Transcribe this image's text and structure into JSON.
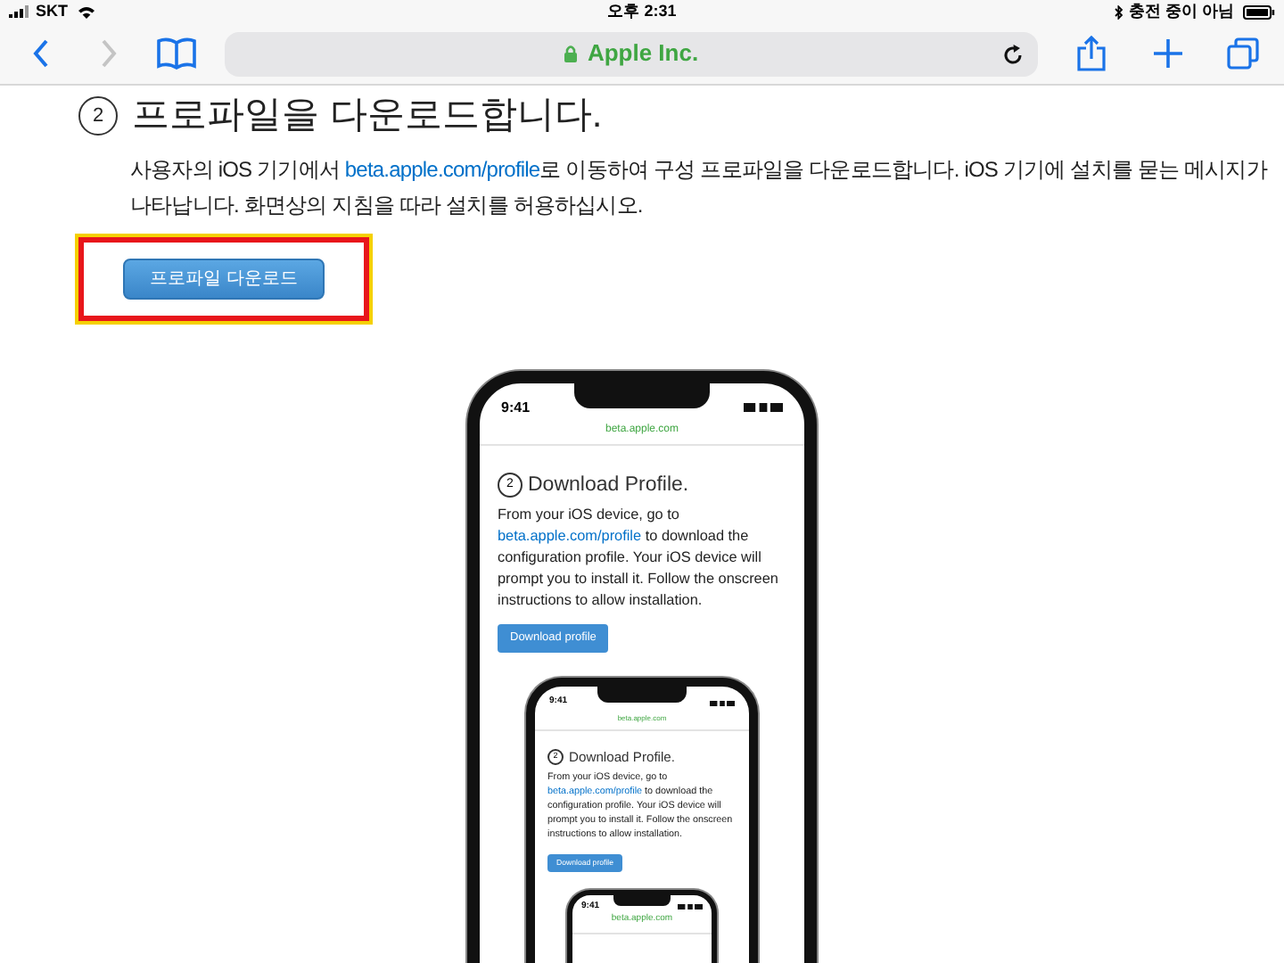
{
  "status_bar": {
    "carrier": "SKT",
    "time": "오후 2:31",
    "charging": "충전 중이 아님"
  },
  "toolbar": {
    "address": "Apple Inc.",
    "back_disabled": false,
    "forward_disabled": true
  },
  "step": {
    "number": "2",
    "title": "프로파일을 다운로드합니다.",
    "text_before": "사용자의 iOS 기기에서 ",
    "link": "beta.apple.com/profile",
    "text_after": "로 이동하여 구성 프로파일을 다운로드합니다. iOS 기기에 설치를 묻는 메시지가 나타납니다. 화면상의 지침을 따라 설치를 허용하십시오.",
    "button": {
      "label": "프로파일 다운로드",
      "highlighted": true
    }
  },
  "phone_preview": {
    "time": "9:41",
    "address": "beta.apple.com",
    "step_number": "2",
    "title": "Download Profile.",
    "text_before": "From your iOS device, go to ",
    "link": "beta.apple.com/profile",
    "text_after": " to download the configuration profile. Your iOS device will prompt you to install it. Follow the onscreen instructions to allow installation.",
    "button": "Download profile",
    "child": {
      "time": "9:41",
      "address": "beta.apple.com",
      "step_number": "2",
      "title": "Download Profile.",
      "text_before": "From your iOS device, go to ",
      "link": "beta.apple.com/profile",
      "text_after": " to download the configuration profile. Your iOS device will prompt you to install it. Follow the onscreen instructions to allow installation.",
      "button": "Download profile",
      "child": {
        "time": "9:41",
        "address": "beta.apple.com"
      }
    }
  }
}
